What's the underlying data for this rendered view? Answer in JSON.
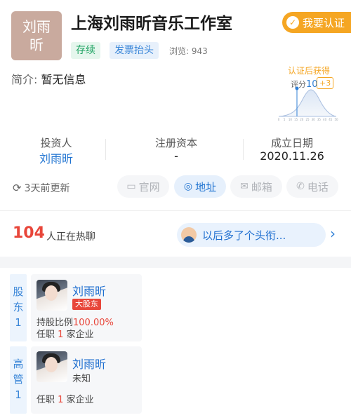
{
  "company": {
    "logo_line1": "刘雨",
    "logo_line2": "昕",
    "name": "上海刘雨昕音乐工作室",
    "tag_status": "存续",
    "tag_invoice": "发票抬头",
    "views_label": "浏览:",
    "views_count": "943",
    "intro_label": "简介:",
    "intro_value": "暂无信息",
    "cert_button": "我要认证"
  },
  "score": {
    "cert_badge": "认证后获得",
    "label": "评分",
    "value": "10",
    "plus": "+3",
    "axis_ticks": [
      "0",
      "5",
      "10",
      "15",
      "20",
      "25",
      "30",
      "35",
      "40",
      "45",
      "50"
    ]
  },
  "stats": [
    {
      "label": "投资人",
      "value": "刘雨昕",
      "link": true
    },
    {
      "label": "注册资本",
      "value": "-",
      "link": false
    },
    {
      "label": "成立日期",
      "value": "2020.11.26",
      "link": false
    }
  ],
  "actions": {
    "refresh": "3天前更新",
    "website": "官网",
    "address": "地址",
    "email": "邮箱",
    "phone": "电话"
  },
  "chat": {
    "count": "104",
    "text": "人正在热聊",
    "message": "以后多了个头衔..."
  },
  "shareholders": {
    "tab": [
      "股",
      "东",
      "1"
    ],
    "name": "刘雨昕",
    "badge": "大股东",
    "ratio_label": "持股比例",
    "ratio_value": "100.00%",
    "office_prefix": "任职",
    "office_count": "1",
    "office_suffix": "家企业"
  },
  "executives": {
    "tab": [
      "高",
      "管",
      "1"
    ],
    "name": "刘雨昕",
    "role": "未知",
    "office_prefix": "任职",
    "office_count": "1",
    "office_suffix": "家企业"
  },
  "colors": {
    "accent_blue": "#1f73d1",
    "red": "#e8463a",
    "orange": "#f5a623",
    "green": "#1fa362"
  }
}
